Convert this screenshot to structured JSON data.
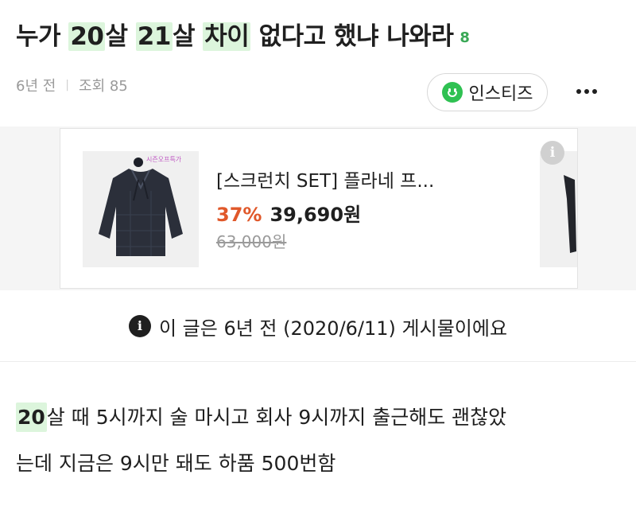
{
  "post": {
    "title_parts": [
      {
        "text": "누가 ",
        "hl": false
      },
      {
        "text": "20",
        "hl": true
      },
      {
        "text": "살 ",
        "hl": false
      },
      {
        "text": "21",
        "hl": true
      },
      {
        "text": "살 ",
        "hl": false
      },
      {
        "text": "차이",
        "hl": true
      },
      {
        "text": " 없다고 했냐 나와라",
        "hl": false
      }
    ],
    "comment_count": "8",
    "time_ago": "6년 전",
    "views": "조회 85",
    "board_name": "인스티즈"
  },
  "ad": {
    "image_tag": "시즌오프특가",
    "product_name": "[스크런치 SET] 플라네 프...",
    "discount": "37%",
    "price": "39,690원",
    "original_price": "63,000원",
    "info_icon": "i"
  },
  "notice": {
    "icon": "i",
    "text": "이 글은 6년 전 (2020/6/11) 게시물이에요"
  },
  "content": {
    "line1_hl": "20",
    "line1_rest": "살 때 5시까지 술 마시고 회사 9시까지 출근해도 괜찮았",
    "line2": "는데 지금은 9시만 돼도 하품 500번함"
  },
  "colors": {
    "highlight": "#dcf5dc",
    "accent_green": "#2fc152",
    "discount_orange": "#e0582a"
  }
}
